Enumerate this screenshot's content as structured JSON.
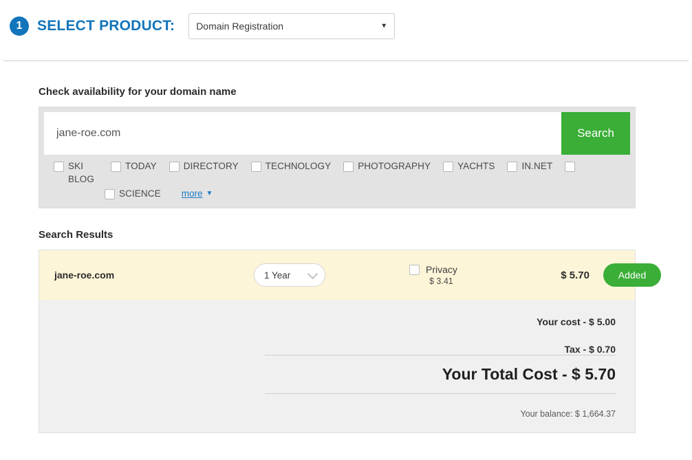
{
  "step": {
    "number": "1",
    "title": "SELECT PRODUCT:",
    "product_selected": "Domain Registration",
    "product_options": [
      "Domain Registration"
    ],
    "caret_glyph": "▼"
  },
  "search": {
    "heading": "Check availability for your domain name",
    "value": "jane-roe.com",
    "placeholder": "jane-roe.com",
    "button_label": "Search",
    "more_label": "more",
    "more_caret": "▼",
    "tlds": [
      {
        "label": "SKI BLOG",
        "checked": false
      },
      {
        "label": "TODAY",
        "checked": false
      },
      {
        "label": "DIRECTORY",
        "checked": false
      },
      {
        "label": "TECHNOLOGY",
        "checked": false
      },
      {
        "label": "PHOTOGRAPHY",
        "checked": false
      },
      {
        "label": "YACHTS",
        "checked": false
      },
      {
        "label": "IN.NET",
        "checked": false
      },
      {
        "label": "",
        "checked": false
      },
      {
        "label": "SCIENCE",
        "checked": false
      }
    ]
  },
  "results": {
    "heading": "Search Results",
    "row": {
      "domain": "jane-roe.com",
      "term_selected": "1 Year",
      "term_options": [
        "1 Year"
      ],
      "privacy_label": "Privacy",
      "privacy_price": "$ 3.41",
      "privacy_checked": false,
      "price": "$ 5.70",
      "action_label": "Added"
    }
  },
  "summary": {
    "cost_line": "Your cost - $ 5.00",
    "tax_line": "Tax - $ 0.70",
    "total_line": "Your Total Cost - $ 5.70",
    "balance_line": "Your balance: $ 1,664.37"
  },
  "colors": {
    "brand_blue": "#1275bc",
    "action_green": "#3aae37",
    "result_highlight": "#fdf5d8",
    "summary_bg": "#f0f0f0",
    "link_blue": "#1d7cc4"
  }
}
